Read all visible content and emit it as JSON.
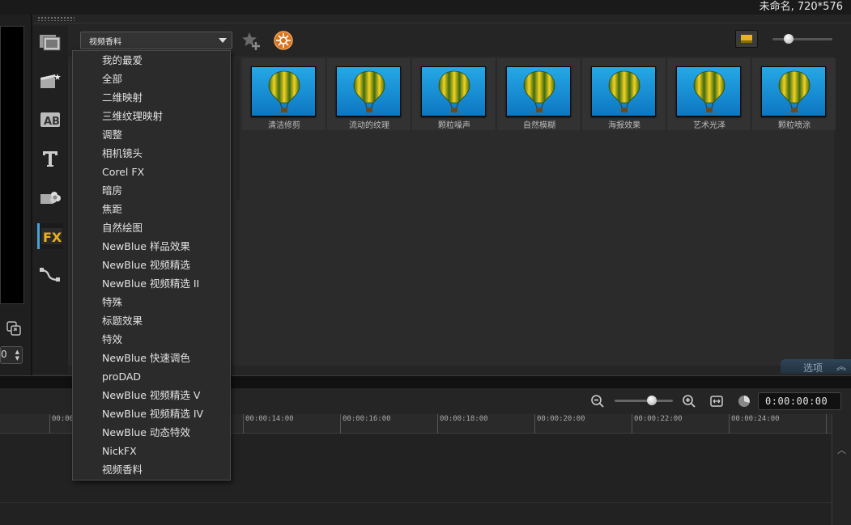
{
  "window": {
    "project_info": "未命名, 720*576"
  },
  "preview": {
    "spin_value": "0"
  },
  "library": {
    "category_select": {
      "value": "视频香料"
    },
    "thumbnails": [
      {
        "label": "清洁修剪"
      },
      {
        "label": "流动的纹理"
      },
      {
        "label": "颗粒噪声"
      },
      {
        "label": "自然模糊"
      },
      {
        "label": "海报效果"
      },
      {
        "label": "艺术光泽"
      },
      {
        "label": "颗粒喷涂"
      }
    ],
    "options_label": "选项"
  },
  "dropdown": {
    "items": [
      "我的最爱",
      "全部",
      "二维映射",
      "三维纹理映射",
      "调整",
      "相机镜头",
      "Corel FX",
      "暗房",
      "焦距",
      "自然绘图",
      "NewBlue 样品效果",
      "NewBlue 视频精选",
      "NewBlue 视频精选 II",
      "特殊",
      "标题效果",
      "特效",
      "NewBlue 快速调色",
      "proDAD",
      "NewBlue 视频精选 V",
      "NewBlue 视频精选 IV",
      "NewBlue 动态特效",
      "NickFX",
      "视频香料"
    ]
  },
  "timeline": {
    "timecode": "0:00:00:00",
    "ruler_ticks": [
      "00:00",
      "00:00:14:00",
      "00:00:16:00",
      "00:00:18:00",
      "00:00:20:00",
      "00:00:22:00",
      "00:00:24:00"
    ]
  },
  "colors": {
    "accent_blue": "#4aa0d8",
    "fx_yellow": "#e9b21d",
    "thumb_sky": "#1896db"
  }
}
